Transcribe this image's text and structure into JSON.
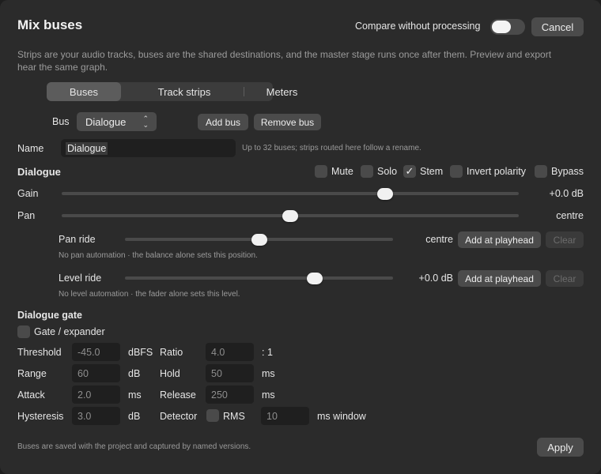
{
  "header": {
    "title": "Mix buses",
    "compare_label": "Compare without processing",
    "compare_on": false,
    "cancel_label": "Cancel"
  },
  "description": "Strips are your audio tracks, buses are the shared destinations, and the master stage runs once after them. Preview and export hear the same graph.",
  "tabs": [
    {
      "label": "Buses",
      "selected": true
    },
    {
      "label": "Track strips",
      "selected": false
    },
    {
      "label": "Meters",
      "selected": false
    }
  ],
  "bus_row": {
    "label": "Bus",
    "selected": "Dialogue",
    "add_label": "Add bus",
    "remove_label": "Remove bus"
  },
  "name_row": {
    "label": "Name",
    "value": "Dialogue",
    "hint": "Up to 32 buses; strips routed here follow a rename."
  },
  "bus_section": {
    "heading": "Dialogue",
    "flags": [
      {
        "label": "Mute",
        "checked": false
      },
      {
        "label": "Solo",
        "checked": false
      },
      {
        "label": "Stem",
        "checked": true
      },
      {
        "label": "Invert polarity",
        "checked": false
      },
      {
        "label": "Bypass",
        "checked": false
      }
    ],
    "gain": {
      "label": "Gain",
      "value": "+0.0 dB",
      "position": 0.708
    },
    "pan": {
      "label": "Pan",
      "value": "centre",
      "position": 0.5
    },
    "pan_ride": {
      "label": "Pan ride",
      "value": "centre",
      "position": 0.5,
      "add_label": "Add at playhead",
      "clear_label": "Clear",
      "note": "No pan automation · the balance alone sets this position."
    },
    "level_ride": {
      "label": "Level ride",
      "value": "+0.0 dB",
      "position": 0.708,
      "add_label": "Add at playhead",
      "clear_label": "Clear",
      "note": "No level automation · the fader alone sets this level."
    }
  },
  "gate": {
    "heading": "Dialogue gate",
    "enable_label": "Gate / expander",
    "enabled": false,
    "threshold": {
      "label": "Threshold",
      "value": "-45.0",
      "unit": "dBFS"
    },
    "ratio": {
      "label": "Ratio",
      "value": "4.0",
      "unit": ": 1"
    },
    "range": {
      "label": "Range",
      "value": "60",
      "unit": "dB"
    },
    "hold": {
      "label": "Hold",
      "value": "50",
      "unit": "ms"
    },
    "attack": {
      "label": "Attack",
      "value": "2.0",
      "unit": "ms"
    },
    "release": {
      "label": "Release",
      "value": "250",
      "unit": "ms"
    },
    "hysteresis": {
      "label": "Hysteresis",
      "value": "3.0",
      "unit": "dB"
    },
    "detector": {
      "label": "Detector",
      "rms_label": "RMS",
      "rms_checked": false,
      "window_value": "10",
      "window_unit": "ms window"
    }
  },
  "footer": {
    "note": "Buses are saved with the project and captured by named versions.",
    "apply_label": "Apply"
  },
  "icons": {
    "chevron": "chevron-up-down-icon",
    "check": "checkmark-icon"
  }
}
